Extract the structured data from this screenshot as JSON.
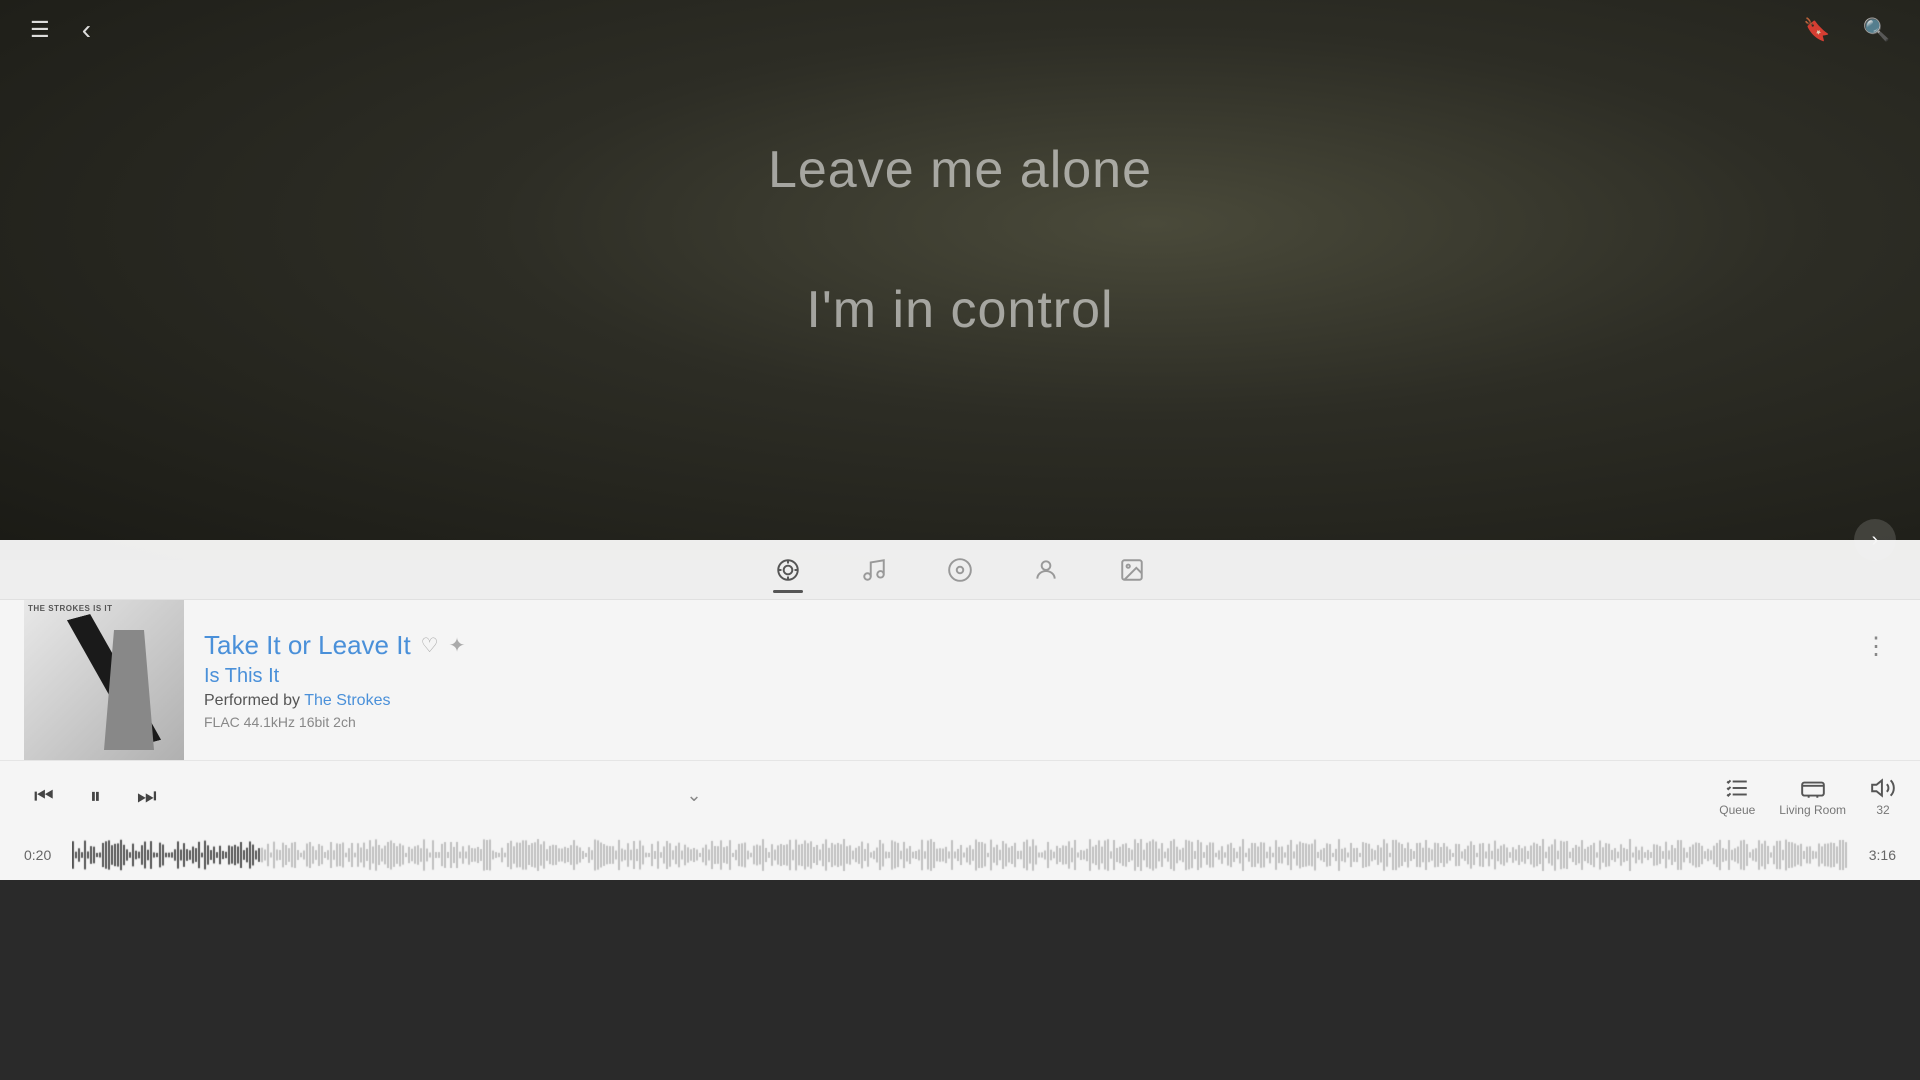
{
  "topbar": {
    "menu_icon": "☰",
    "back_icon": "‹",
    "bookmark_icon": "🔖",
    "search_icon": "🔍"
  },
  "lyrics": {
    "line1": "Leave me alone",
    "line2": "I'm in control"
  },
  "next_arrow": "›",
  "tabs": [
    {
      "id": "lyrics",
      "icon": "🎤",
      "active": true
    },
    {
      "id": "queue",
      "icon": "≡",
      "active": false
    },
    {
      "id": "disc",
      "icon": "⏺",
      "active": false
    },
    {
      "id": "artist",
      "icon": "👤",
      "active": false
    },
    {
      "id": "image",
      "icon": "🖼",
      "active": false
    }
  ],
  "track": {
    "title": "Take It or Leave It",
    "heart": "♡",
    "sparkle": "✦",
    "album": "Is This It",
    "performed_by_label": "Performed by",
    "artist": "The Strokes",
    "format": "FLAC 44.1kHz 16bit 2ch",
    "album_art_label": "THE STROKES IS IT"
  },
  "more_btn": "⋮",
  "transport": {
    "prev": "⏮",
    "pause": "⏸",
    "next": "⏭",
    "collapse": "⌄"
  },
  "right_controls": {
    "queue_icon": "🎵",
    "queue_label": "Queue",
    "living_room_icon": "📦",
    "living_room_label": "Living Room",
    "volume_icon": "🔊",
    "volume_value": "32"
  },
  "progress": {
    "current": "0:20",
    "total": "3:16",
    "percent": 10.6
  }
}
